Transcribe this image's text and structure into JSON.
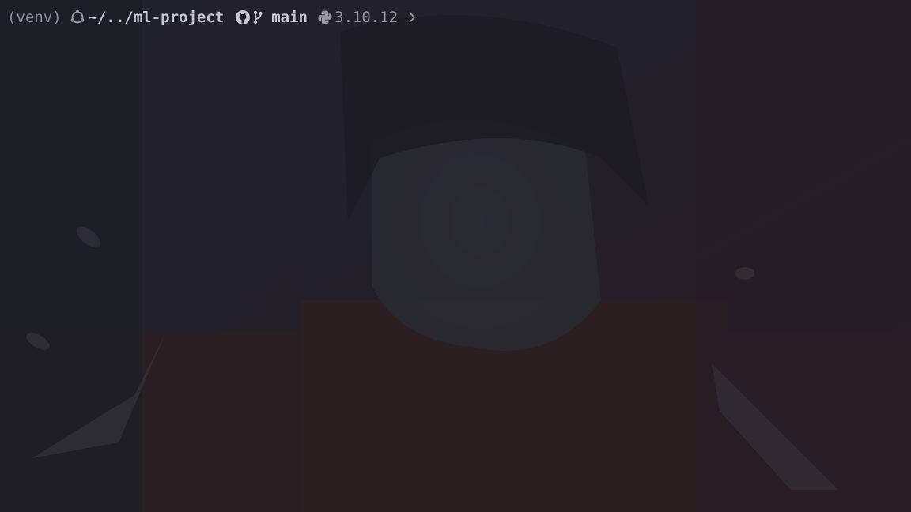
{
  "prompt": {
    "venv": "(venv)",
    "os_icon": "ubuntu-icon",
    "cwd": "~/../ml-project",
    "vcs_icon": "github-icon",
    "branch_icon": "git-branch-icon",
    "branch": "main",
    "lang_icon": "python-icon",
    "python_version": "3.10.12",
    "prompt_symbol_icon": "chevron-right-icon"
  },
  "colors": {
    "background": "#1f1e27",
    "prompt_dim": "#9a98a6",
    "prompt_bright": "#c8c6d2"
  }
}
